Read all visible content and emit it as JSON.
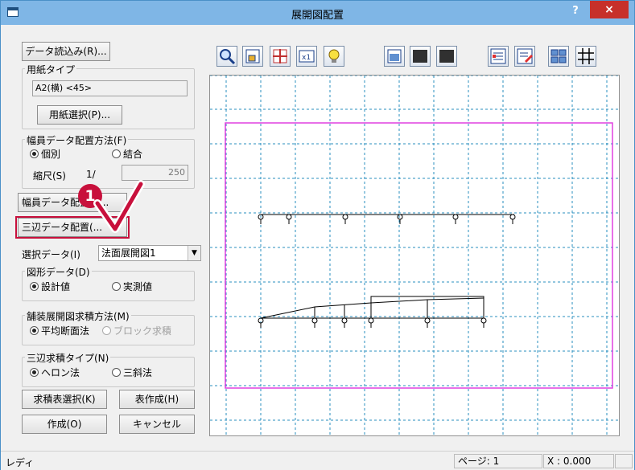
{
  "window": {
    "title": "展開図配置",
    "help": "?",
    "close": "×"
  },
  "left_panel": {
    "load_data_button": "データ読込み(R)...",
    "paper_type": {
      "label": "用紙タイプ",
      "value": "A2(横) <45>",
      "select_button": "用紙選択(P)..."
    },
    "width_data": {
      "label": "幅員データ配置方法(F)",
      "option_individual": "個別",
      "option_combine": "結合",
      "scale_label": "縮尺(S)",
      "scale_prefix": "1/",
      "scale_value": "250",
      "place_button": "幅員データ配置(J)..."
    },
    "triangle_place_button": "三辺データ配置(...",
    "select_data": {
      "label": "選択データ(I)",
      "value": "法面展開図1"
    },
    "shape_data": {
      "label": "図形データ(D)",
      "option_design": "設計値",
      "option_actual": "実測値"
    },
    "pavement_method": {
      "label": "舗装展開図求積方法(M)",
      "option_average": "平均断面法",
      "option_block": "ブロック求積"
    },
    "triangle_type": {
      "label": "三辺求積タイプ(N)",
      "option_heron": "ヘロン法",
      "option_three": "三斜法"
    },
    "quad_table_button": "求積表選択(K)",
    "table_create_button": "表作成(H)",
    "create_button": "作成(O)",
    "cancel_button": "キャンセル"
  },
  "toolbar": {
    "icons": [
      "zoom-icon",
      "fit-view-icon",
      "move-icon",
      "scale-1x-icon",
      "bulb-icon",
      "layout-icon",
      "sheet-dark-icon",
      "sheet-dark2-icon",
      "list-icon",
      "edit-list-icon",
      "arrange-icon",
      "grid-icon"
    ]
  },
  "callout": {
    "number": "1"
  },
  "status": {
    "text": "レディ",
    "page": "ページ: 1",
    "x": "X : 0.000"
  },
  "colors": {
    "titlebar": "#7fb6e6",
    "close": "#c7302a",
    "paper_border": "#e040e0",
    "grid": "#2a8fbf",
    "callout": "#c8103c"
  }
}
